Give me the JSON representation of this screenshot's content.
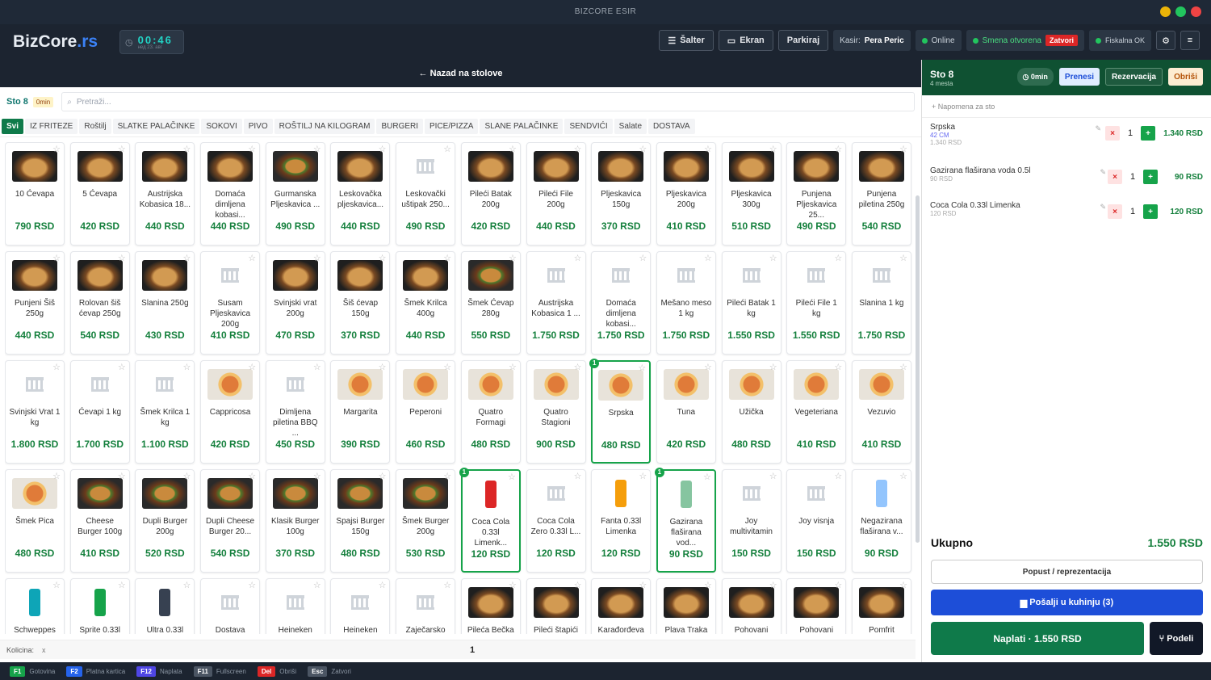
{
  "window": {
    "title": "BIZCORE ESIR"
  },
  "header": {
    "logo_main": "BizCore",
    "logo_ext": ".rs",
    "clock": "00:46",
    "clock_date": "нед 23. авг",
    "salter": "Šalter",
    "ekran": "Ekran",
    "parkiraj": "Parkiraj",
    "kasir_label": "Kasir:",
    "kasir_name": "Pera Peric",
    "online": "Online",
    "smena": "Smena otvorena",
    "zatvori": "Zatvori",
    "fiskalna": "Fiskalna OK"
  },
  "back": "← Nazad na stolove",
  "table": {
    "label": "Sto 8",
    "time": "0min",
    "search_placeholder": "Pretraži..."
  },
  "categories": [
    "Svi",
    "IZ FRITEZE",
    "Roštilj",
    "SLATKE PALAČINKE",
    "SOKOVI",
    "PIVO",
    "ROŠTILJ NA KILOGRAM",
    "BURGERI",
    "PICE/PIZZA",
    "SLANE PALAČINKE",
    "SENDVIĆI",
    "Salate",
    "DOSTAVA"
  ],
  "products": [
    {
      "name": "10 Ćevapa",
      "price": "790 RSD",
      "img": "food"
    },
    {
      "name": "5 Ćevapa",
      "price": "420 RSD",
      "img": "food"
    },
    {
      "name": "Austrijska Kobasica 18...",
      "price": "440 RSD",
      "img": "food"
    },
    {
      "name": "Domaća dimljena kobasi...",
      "price": "440 RSD",
      "img": "food"
    },
    {
      "name": "Gurmanska Pljeskavica ...",
      "price": "490 RSD",
      "img": "burger"
    },
    {
      "name": "Leskovačka pljeskavica...",
      "price": "440 RSD",
      "img": "food"
    },
    {
      "name": "Leskovački uštipak 250...",
      "price": "490 RSD",
      "img": "ph"
    },
    {
      "name": "Pileći Batak 200g",
      "price": "420 RSD",
      "img": "food"
    },
    {
      "name": "Pileći File 200g",
      "price": "440 RSD",
      "img": "food"
    },
    {
      "name": "Pljeskavica 150g",
      "price": "370 RSD",
      "img": "food"
    },
    {
      "name": "Pljeskavica 200g",
      "price": "410 RSD",
      "img": "food"
    },
    {
      "name": "Pljeskavica 300g",
      "price": "510 RSD",
      "img": "food"
    },
    {
      "name": "Punjena Pljeskavica 25...",
      "price": "490 RSD",
      "img": "food"
    },
    {
      "name": "Punjena piletina 250g",
      "price": "540 RSD",
      "img": "food"
    },
    {
      "name": "Punjeni Šiš 250g",
      "price": "440 RSD",
      "img": "food"
    },
    {
      "name": "Rolovan šiš ćevap 250g",
      "price": "540 RSD",
      "img": "food"
    },
    {
      "name": "Slanina 250g",
      "price": "430 RSD",
      "img": "food"
    },
    {
      "name": "Susam Pljeskavica 200g",
      "price": "410 RSD",
      "img": "ph"
    },
    {
      "name": "Svinjski vrat 200g",
      "price": "470 RSD",
      "img": "food"
    },
    {
      "name": "Šiš ćevap 150g",
      "price": "370 RSD",
      "img": "food"
    },
    {
      "name": "Šmek Krilca 400g",
      "price": "440 RSD",
      "img": "food"
    },
    {
      "name": "Šmek Ćevap 280g",
      "price": "550 RSD",
      "img": "burger"
    },
    {
      "name": "Austrijska Kobasica 1 ...",
      "price": "1.750 RSD",
      "img": "ph"
    },
    {
      "name": "Domaća dimljena kobasi...",
      "price": "1.750 RSD",
      "img": "ph"
    },
    {
      "name": "Mešano meso 1 kg",
      "price": "1.750 RSD",
      "img": "ph"
    },
    {
      "name": "Pileći Batak 1 kg",
      "price": "1.550 RSD",
      "img": "ph"
    },
    {
      "name": "Pileći File 1 kg",
      "price": "1.550 RSD",
      "img": "ph"
    },
    {
      "name": "Slanina 1 kg",
      "price": "1.750 RSD",
      "img": "ph"
    },
    {
      "name": "Svinjski Vrat 1 kg",
      "price": "1.800 RSD",
      "img": "ph"
    },
    {
      "name": "Ćevapi 1 kg",
      "price": "1.700 RSD",
      "img": "ph"
    },
    {
      "name": "Šmek Krilca 1 kg",
      "price": "1.100 RSD",
      "img": "ph"
    },
    {
      "name": "Cappricosa",
      "price": "420 RSD",
      "img": "pizza"
    },
    {
      "name": "Dimljena piletina BBQ ...",
      "price": "450 RSD",
      "img": "ph"
    },
    {
      "name": "Margarita",
      "price": "390 RSD",
      "img": "pizza"
    },
    {
      "name": "Peperoni",
      "price": "460 RSD",
      "img": "pizza"
    },
    {
      "name": "Quatro Formagi",
      "price": "480 RSD",
      "img": "pizza"
    },
    {
      "name": "Quatro Stagioni",
      "price": "900 RSD",
      "img": "pizza"
    },
    {
      "name": "Srpska",
      "price": "480 RSD",
      "img": "pizza",
      "qty": "1"
    },
    {
      "name": "Tuna",
      "price": "420 RSD",
      "img": "pizza"
    },
    {
      "name": "Užička",
      "price": "480 RSD",
      "img": "pizza"
    },
    {
      "name": "Vegeteriana",
      "price": "410 RSD",
      "img": "pizza"
    },
    {
      "name": "Vezuvio",
      "price": "410 RSD",
      "img": "pizza"
    },
    {
      "name": "Šmek Pica",
      "price": "480 RSD",
      "img": "pizza"
    },
    {
      "name": "Cheese Burger 100g",
      "price": "410 RSD",
      "img": "burger"
    },
    {
      "name": "Dupli Burger 200g",
      "price": "520 RSD",
      "img": "burger"
    },
    {
      "name": "Dupli Cheese Burger 20...",
      "price": "540 RSD",
      "img": "burger"
    },
    {
      "name": "Klasik Burger 100g",
      "price": "370 RSD",
      "img": "burger"
    },
    {
      "name": "Spajsi Burger 150g",
      "price": "480 RSD",
      "img": "burger"
    },
    {
      "name": "Šmek Burger 200g",
      "price": "530 RSD",
      "img": "burger"
    },
    {
      "name": "Coca Cola 0.33l Limenk...",
      "price": "120 RSD",
      "img": "can",
      "color": "#dc2626",
      "qty": "1"
    },
    {
      "name": "Coca Cola Zero 0.33l L...",
      "price": "120 RSD",
      "img": "ph"
    },
    {
      "name": "Fanta 0.33l Limenka",
      "price": "120 RSD",
      "img": "can",
      "color": "#f59e0b"
    },
    {
      "name": "Gazirana flaširana vod...",
      "price": "90 RSD",
      "img": "can",
      "color": "#86c5a0",
      "qty": "1"
    },
    {
      "name": "Joy multivitamin",
      "price": "150 RSD",
      "img": "ph"
    },
    {
      "name": "Joy visnja",
      "price": "150 RSD",
      "img": "ph"
    },
    {
      "name": "Negazirana flaširana v...",
      "price": "90 RSD",
      "img": "can",
      "color": "#93c5fd"
    },
    {
      "name": "Schweppes",
      "price": "",
      "img": "can",
      "color": "#0ea5b7"
    },
    {
      "name": "Sprite 0.33l",
      "price": "",
      "img": "can",
      "color": "#16a34a"
    },
    {
      "name": "Ultra 0.33l",
      "price": "",
      "img": "can",
      "color": "#374151"
    },
    {
      "name": "Dostava",
      "price": "",
      "img": "ph"
    },
    {
      "name": "Heineken",
      "price": "",
      "img": "ph"
    },
    {
      "name": "Heineken",
      "price": "",
      "img": "ph"
    },
    {
      "name": "Zaječarsko",
      "price": "",
      "img": "ph"
    },
    {
      "name": "Pileća Bečka",
      "price": "",
      "img": "food"
    },
    {
      "name": "Pileći štapići",
      "price": "",
      "img": "food"
    },
    {
      "name": "Karađorđeva",
      "price": "",
      "img": "food"
    },
    {
      "name": "Plava Traka",
      "price": "",
      "img": "food"
    },
    {
      "name": "Pohovani",
      "price": "",
      "img": "food"
    },
    {
      "name": "Pohovani",
      "price": "",
      "img": "food"
    },
    {
      "name": "Pomfrit",
      "price": "",
      "img": "food"
    }
  ],
  "quantity": {
    "label": "Kolicina:",
    "x": "x",
    "value": "1"
  },
  "order": {
    "title": "Sto 8",
    "seats": "4 mesta",
    "time": "0min",
    "prenesi": "Prenesi",
    "rezervacija": "Rezervacija",
    "obrisi": "Obriši",
    "note": "+ Napomena za sto",
    "items": [
      {
        "name": "Srpska",
        "sub": "42 CM",
        "unit": "1.340 RSD",
        "qty": "1",
        "total": "1.340 RSD"
      },
      {
        "name": "Gazirana flaširana voda 0.5l",
        "sub": "",
        "unit": "90 RSD",
        "qty": "1",
        "total": "90 RSD"
      },
      {
        "name": "Coca Cola 0.33l Limenka",
        "sub": "",
        "unit": "120 RSD",
        "qty": "1",
        "total": "120 RSD"
      }
    ],
    "total_label": "Ukupno",
    "total": "1.550 RSD",
    "popust": "Popust / reprezentacija",
    "kuhinja": "Pošalji u kuhinju (3)",
    "naplati": "Naplati · 1.550 RSD",
    "podeli": "⑂ Podeli"
  },
  "footer": [
    {
      "key": "F1",
      "label": "Gotovina",
      "color": "#16a34a"
    },
    {
      "key": "F2",
      "label": "Platna kartica",
      "color": "#2563eb"
    },
    {
      "key": "F12",
      "label": "Naplata",
      "color": "#4f46e5"
    },
    {
      "key": "F11",
      "label": "Fullscreen",
      "color": "#4b5563"
    },
    {
      "key": "Del",
      "label": "Obriši",
      "color": "#dc2626"
    },
    {
      "key": "Esc",
      "label": "Zatvori",
      "color": "#4b5563"
    }
  ]
}
